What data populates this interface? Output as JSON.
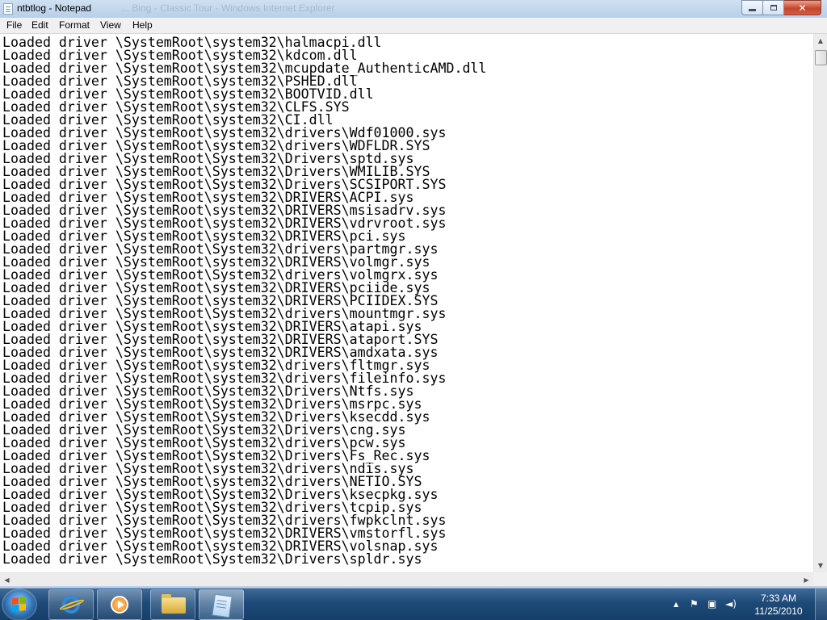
{
  "window": {
    "title": "ntbtlog - Notepad",
    "title_ghost": "... Bing - Classic Tour - Windows Internet Explorer",
    "controls": {
      "minimize": "minimize",
      "maximize": "maximize",
      "close": "✕"
    }
  },
  "menubar": {
    "items": [
      "File",
      "Edit",
      "Format",
      "View",
      "Help"
    ]
  },
  "editor": {
    "lines": [
      "Loaded driver \\SystemRoot\\system32\\halmacpi.dll",
      "Loaded driver \\SystemRoot\\system32\\kdcom.dll",
      "Loaded driver \\SystemRoot\\system32\\mcupdate_AuthenticAMD.dll",
      "Loaded driver \\SystemRoot\\system32\\PSHED.dll",
      "Loaded driver \\SystemRoot\\system32\\BOOTVID.dll",
      "Loaded driver \\SystemRoot\\system32\\CLFS.SYS",
      "Loaded driver \\SystemRoot\\system32\\CI.dll",
      "Loaded driver \\SystemRoot\\system32\\drivers\\Wdf01000.sys",
      "Loaded driver \\SystemRoot\\system32\\drivers\\WDFLDR.SYS",
      "Loaded driver \\SystemRoot\\System32\\Drivers\\sptd.sys",
      "Loaded driver \\SystemRoot\\System32\\Drivers\\WMILIB.SYS",
      "Loaded driver \\SystemRoot\\System32\\Drivers\\SCSIPORT.SYS",
      "Loaded driver \\SystemRoot\\system32\\DRIVERS\\ACPI.sys",
      "Loaded driver \\SystemRoot\\system32\\DRIVERS\\msisadrv.sys",
      "Loaded driver \\SystemRoot\\system32\\DRIVERS\\vdrvroot.sys",
      "Loaded driver \\SystemRoot\\system32\\DRIVERS\\pci.sys",
      "Loaded driver \\SystemRoot\\System32\\drivers\\partmgr.sys",
      "Loaded driver \\SystemRoot\\system32\\DRIVERS\\volmgr.sys",
      "Loaded driver \\SystemRoot\\System32\\drivers\\volmgrx.sys",
      "Loaded driver \\SystemRoot\\system32\\DRIVERS\\pciide.sys",
      "Loaded driver \\SystemRoot\\system32\\DRIVERS\\PCIIDEX.SYS",
      "Loaded driver \\SystemRoot\\System32\\drivers\\mountmgr.sys",
      "Loaded driver \\SystemRoot\\system32\\DRIVERS\\atapi.sys",
      "Loaded driver \\SystemRoot\\system32\\DRIVERS\\ataport.SYS",
      "Loaded driver \\SystemRoot\\system32\\DRIVERS\\amdxata.sys",
      "Loaded driver \\SystemRoot\\system32\\drivers\\fltmgr.sys",
      "Loaded driver \\SystemRoot\\system32\\drivers\\fileinfo.sys",
      "Loaded driver \\SystemRoot\\System32\\Drivers\\Ntfs.sys",
      "Loaded driver \\SystemRoot\\System32\\Drivers\\msrpc.sys",
      "Loaded driver \\SystemRoot\\System32\\Drivers\\ksecdd.sys",
      "Loaded driver \\SystemRoot\\System32\\Drivers\\cng.sys",
      "Loaded driver \\SystemRoot\\System32\\drivers\\pcw.sys",
      "Loaded driver \\SystemRoot\\System32\\Drivers\\Fs_Rec.sys",
      "Loaded driver \\SystemRoot\\system32\\drivers\\ndis.sys",
      "Loaded driver \\SystemRoot\\system32\\drivers\\NETIO.SYS",
      "Loaded driver \\SystemRoot\\System32\\Drivers\\ksecpkg.sys",
      "Loaded driver \\SystemRoot\\System32\\drivers\\tcpip.sys",
      "Loaded driver \\SystemRoot\\System32\\drivers\\fwpkclnt.sys",
      "Loaded driver \\SystemRoot\\system32\\DRIVERS\\vmstorfl.sys",
      "Loaded driver \\SystemRoot\\system32\\DRIVERS\\volsnap.sys",
      "Loaded driver \\SystemRoot\\System32\\Drivers\\spldr.sys"
    ]
  },
  "scrollbars": {
    "up": "▲",
    "down": "▼",
    "left": "◀",
    "right": "▶"
  },
  "taskbar": {
    "pinned": [
      "internet-explorer-icon",
      "media-player-icon",
      "windows-explorer-icon",
      "notepad-icon"
    ],
    "tray": {
      "show_hidden": "▲",
      "flag": "⚑",
      "network": "▣",
      "volume": "◄)"
    },
    "clock": {
      "time": "7:33 AM",
      "date": "11/25/2010"
    }
  }
}
